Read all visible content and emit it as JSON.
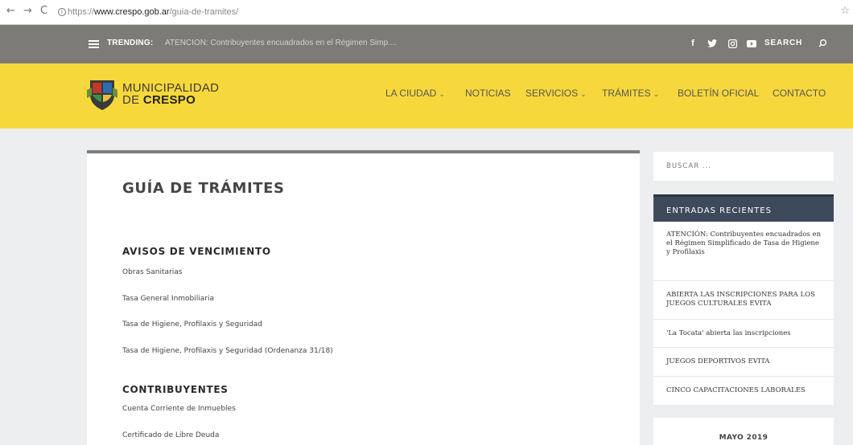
{
  "browser": {
    "url_scheme": "https://",
    "url_host": "www.crespo.gob.ar",
    "url_path": "/guia-de-tramites/"
  },
  "topbar": {
    "trending_label": "TRENDING:",
    "trending_text": "ATENCION: Contribuyentes encuadrados en el Régimen Simp....",
    "search_label": "SEARCH",
    "social": [
      "f",
      "twitter-icon",
      "instagram-icon",
      "youtube-icon"
    ]
  },
  "header": {
    "logo_line1": "MUNICIPALIDAD",
    "logo_line2_prefix": "DE",
    "logo_line2_bold": "CRESPO",
    "nav": [
      "LA CIUDAD",
      "NOTICIAS",
      "SERVICIOS",
      "TRÁMITES",
      "BOLETÍN OFICIAL",
      "CONTACTO"
    ],
    "colors": {
      "header_bg": "#f7d83c",
      "topbar_bg": "#7c7b76"
    }
  },
  "main": {
    "title": "GUÍA DE TRÁMITES",
    "sections": [
      {
        "heading": "AVISOS DE VENCIMIENTO",
        "links": [
          "Obras Sanitarias",
          "Tasa General Inmobiliaria",
          "Tasa de Higiene, Profilaxis y Seguridad",
          "Tasa de Higiene, Profilaxis y Seguridad (Ordenanza 31/18)"
        ]
      },
      {
        "heading": "CONTRIBUYENTES",
        "links": [
          "Cuenta Corriente de Inmuebles",
          "Certificado de Libre Deuda"
        ]
      }
    ]
  },
  "sidebar": {
    "search_placeholder": "BUSCAR ...",
    "recent_heading": "ENTRADAS RECIENTES",
    "recent": [
      "ATENCIÓN: Contribuyentes encuadrados en el Régimen Simplificado de Tasa de Higiene y Profilaxis",
      "ABIERTA LAS INSCRIPCIONES PARA LOS JUEGOS CULTURALES EVITA",
      "'La Tocata' abierta las inscripciones",
      "JUEGOS DEPORTIVOS EVITA",
      "CINCO CAPACITACIONES LABORALES"
    ],
    "calendar_title": "MAYO 2019"
  }
}
